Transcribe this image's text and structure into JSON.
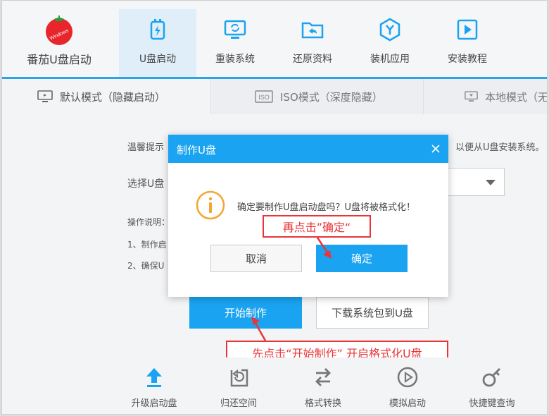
{
  "brand": {
    "name": "番茄U盘启动",
    "logo_text": "Windows",
    "accent": "#2ba3e8"
  },
  "nav": {
    "tabs": [
      {
        "label": "U盘启动",
        "icon": "usb-drive-icon",
        "active": true
      },
      {
        "label": "重装系统",
        "icon": "monitor-refresh-icon",
        "active": false
      },
      {
        "label": "还原资料",
        "icon": "folder-restore-icon",
        "active": false
      },
      {
        "label": "装机应用",
        "icon": "app-hexagon-icon",
        "active": false
      },
      {
        "label": "安装教程",
        "icon": "video-play-icon",
        "active": false
      }
    ]
  },
  "modes": {
    "tabs": [
      {
        "label": "默认模式（隐藏启动）",
        "icon": "monitor-icon",
        "active": true
      },
      {
        "label": "ISO模式（深度隐藏）",
        "icon": "iso-icon",
        "active": false
      },
      {
        "label": "本地模式（无",
        "icon": "local-monitor-icon",
        "active": false
      }
    ]
  },
  "content": {
    "tip_prefix": "温馨提示",
    "tip_suffix": "以便从U盘安装系统。",
    "select_prefix": "选择U盘",
    "instructions_prefix": "操作说明：",
    "step1_prefix": "1、制作启",
    "step2_prefix": "2、确保U",
    "start_button": "开始制作",
    "download_button": "下载系统包到U盘"
  },
  "dialog": {
    "title": "制作U盘",
    "message": "确定要制作U盘启动盘吗？U盘将被格式化！",
    "cancel_label": "取消",
    "confirm_label": "确定"
  },
  "annotations": {
    "confirm_hint": "再点击”确定“",
    "start_hint": "先点击“开始制作” 开启格式化U盘",
    "color": "#e8353a"
  },
  "toolbar": {
    "items": [
      {
        "label": "升级启动盘",
        "icon": "upload-arrow-icon"
      },
      {
        "label": "归还空间",
        "icon": "restore-space-icon"
      },
      {
        "label": "格式转换",
        "icon": "swap-arrows-icon"
      },
      {
        "label": "模拟启动",
        "icon": "play-circle-icon"
      },
      {
        "label": "快捷键查询",
        "icon": "key-icon"
      }
    ]
  }
}
